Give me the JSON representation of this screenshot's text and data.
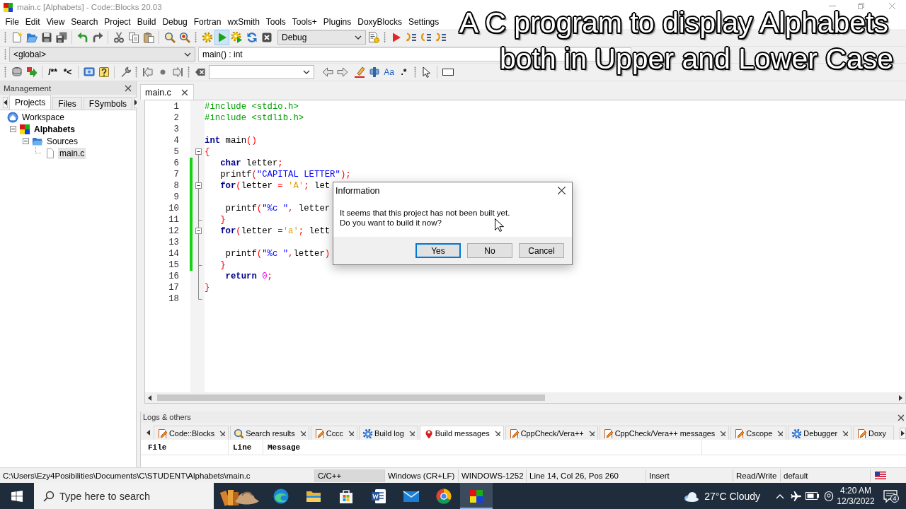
{
  "window": {
    "title": "main.c [Alphabets] - Code::Blocks 20.03"
  },
  "menu": [
    "File",
    "Edit",
    "View",
    "Search",
    "Project",
    "Build",
    "Debug",
    "Fortran",
    "wxSmith",
    "Tools",
    "Tools+",
    "Plugins",
    "DoxyBlocks",
    "Settings"
  ],
  "main_toolbar": {
    "run_highlighted": true,
    "build_target": "Debug"
  },
  "code_toolbar": {
    "scope": "<global>",
    "symbol": "main() : int"
  },
  "doxy_toolbar": {
    "block_comment": "/**",
    "line_comment": "*<"
  },
  "search_toolbar": {
    "match_case": "Aa",
    "regex": ".*"
  },
  "management": {
    "title": "Management",
    "tabs": [
      {
        "label": "Projects",
        "selected": true
      },
      {
        "label": "Files",
        "selected": false
      },
      {
        "label": "FSymbols",
        "selected": false
      }
    ],
    "tree": [
      {
        "label": "Workspace",
        "kind": "workspace",
        "selected": false,
        "active": false,
        "children": [
          {
            "label": "Alphabets",
            "kind": "project",
            "selected": false,
            "active": true,
            "expanded": true,
            "children": [
              {
                "label": "Sources",
                "kind": "folder",
                "selected": false,
                "active": false,
                "expanded": true,
                "children": [
                  {
                    "label": "main.c",
                    "kind": "file",
                    "selected": true,
                    "active": false
                  }
                ]
              }
            ]
          }
        ]
      }
    ]
  },
  "editor": {
    "tabs": [
      {
        "label": "main.c",
        "selected": true
      }
    ],
    "lines": [
      {
        "number": "1",
        "kind": "plain",
        "modified": false,
        "tokens": [
          {
            "kind": "preprocessor",
            "text": "#include <stdio.h>"
          }
        ]
      },
      {
        "number": "2",
        "kind": "plain",
        "modified": false,
        "tokens": [
          {
            "kind": "preprocessor",
            "text": "#include <stdlib.h>"
          }
        ]
      },
      {
        "number": "3",
        "kind": "plain",
        "modified": false
      },
      {
        "number": "4",
        "kind": "plain",
        "modified": false,
        "tokens": [
          {
            "kind": "keyword",
            "text": "int"
          },
          {
            "kind": "plain",
            "text": " main"
          },
          {
            "kind": "operator",
            "text": "()"
          }
        ]
      },
      {
        "number": "5",
        "kind": "fold",
        "modified": false,
        "tokens": [
          {
            "kind": "operator",
            "text": "{"
          }
        ]
      },
      {
        "number": "6",
        "kind": "body",
        "modified": true,
        "tokens": [
          {
            "kind": "keyword",
            "text": "   char"
          },
          {
            "kind": "plain",
            "text": " letter"
          },
          {
            "kind": "operator",
            "text": ";"
          }
        ]
      },
      {
        "number": "7",
        "kind": "body",
        "modified": true,
        "tokens": [
          {
            "kind": "plain",
            "text": "   printf"
          },
          {
            "kind": "operator",
            "text": "("
          },
          {
            "kind": "string",
            "text": "\"CAPITAL LETTER\""
          },
          {
            "kind": "operator",
            "text": ");"
          }
        ]
      },
      {
        "number": "8",
        "kind": "fold",
        "modified": true,
        "tokens": [
          {
            "kind": "keyword",
            "text": "   for"
          },
          {
            "kind": "operator",
            "text": "("
          },
          {
            "kind": "plain",
            "text": "letter "
          },
          {
            "kind": "operator",
            "text": "="
          },
          {
            "kind": "char",
            "text": " 'A'"
          },
          {
            "kind": "operator",
            "text": ";"
          },
          {
            "kind": "plain",
            "text": " let"
          }
        ]
      },
      {
        "number": "9",
        "kind": "body",
        "modified": true
      },
      {
        "number": "10",
        "kind": "body",
        "modified": true,
        "tokens": [
          {
            "kind": "plain",
            "text": "    printf"
          },
          {
            "kind": "operator",
            "text": "("
          },
          {
            "kind": "string",
            "text": "\"%c \""
          },
          {
            "kind": "operator",
            "text": ","
          },
          {
            "kind": "plain",
            "text": " letter"
          }
        ]
      },
      {
        "number": "11",
        "kind": "branch",
        "modified": true,
        "tokens": [
          {
            "kind": "operator",
            "text": "   }"
          }
        ]
      },
      {
        "number": "12",
        "kind": "fold",
        "modified": true,
        "tokens": [
          {
            "kind": "keyword",
            "text": "   for"
          },
          {
            "kind": "operator",
            "text": "("
          },
          {
            "kind": "plain",
            "text": "letter "
          },
          {
            "kind": "operator",
            "text": "="
          },
          {
            "kind": "char",
            "text": "'a'"
          },
          {
            "kind": "operator",
            "text": ";"
          },
          {
            "kind": "plain",
            "text": " lett"
          }
        ]
      },
      {
        "number": "13",
        "kind": "body",
        "modified": true
      },
      {
        "number": "14",
        "kind": "body",
        "modified": true,
        "tokens": [
          {
            "kind": "plain",
            "text": "    printf"
          },
          {
            "kind": "operator",
            "text": "("
          },
          {
            "kind": "string",
            "text": "\"%c \""
          },
          {
            "kind": "operator",
            "text": ","
          },
          {
            "kind": "plain",
            "text": "letter"
          },
          {
            "kind": "operator",
            "text": ")"
          }
        ]
      },
      {
        "number": "15",
        "kind": "branch",
        "modified": true,
        "tokens": [
          {
            "kind": "operator",
            "text": "   }"
          }
        ]
      },
      {
        "number": "16",
        "kind": "body",
        "modified": false,
        "tokens": [
          {
            "kind": "keyword",
            "text": "    return"
          },
          {
            "kind": "number",
            "text": " 0"
          },
          {
            "kind": "operator",
            "text": ";"
          }
        ]
      },
      {
        "number": "17",
        "kind": "body",
        "modified": false,
        "tokens": [
          {
            "kind": "operator",
            "text": "}"
          }
        ]
      },
      {
        "number": "18",
        "kind": "corner",
        "modified": false
      }
    ]
  },
  "dialog": {
    "title": "Information",
    "message": [
      "It seems that this project has not been built yet.",
      "Do you want to build it now?"
    ],
    "buttons": [
      {
        "label": "Yes",
        "focused": true
      },
      {
        "label": "No",
        "focused": false
      },
      {
        "label": "Cancel",
        "focused": false
      }
    ]
  },
  "logs": {
    "title": "Logs & others",
    "tabs": [
      {
        "label": "Code::Blocks",
        "kind": "note",
        "selected": false,
        "closable": true
      },
      {
        "label": "Search results",
        "kind": "search",
        "selected": false,
        "closable": true
      },
      {
        "label": "Cccc",
        "kind": "note",
        "selected": false,
        "closable": true
      },
      {
        "label": "Build log",
        "kind": "gear",
        "selected": false,
        "closable": true
      },
      {
        "label": "Build messages",
        "kind": "pin",
        "selected": true,
        "closable": true
      },
      {
        "label": "CppCheck/Vera++",
        "kind": "note",
        "selected": false,
        "closable": true
      },
      {
        "label": "CppCheck/Vera++ messages",
        "kind": "note",
        "selected": false,
        "closable": true
      },
      {
        "label": "Cscope",
        "kind": "note",
        "selected": false,
        "closable": true
      },
      {
        "label": "Debugger",
        "kind": "gear",
        "selected": false,
        "closable": true
      },
      {
        "label": "Doxy",
        "kind": "note",
        "selected": false,
        "closable": false
      }
    ],
    "columns": [
      "File",
      "Line",
      "Message"
    ]
  },
  "status_bar": [
    {
      "text": "C:\\Users\\Ezy4Posibilities\\Documents\\C\\STUDENT\\Alphabets\\main.c",
      "highlighted": false
    },
    {
      "text": "C/C++",
      "highlighted": true
    },
    {
      "text": "Windows (CR+LF)",
      "highlighted": false
    },
    {
      "text": "WINDOWS-1252",
      "highlighted": false
    },
    {
      "text": "Line 14, Col 26, Pos 260",
      "highlighted": false
    },
    {
      "text": "Insert",
      "highlighted": false
    },
    {
      "text": "Read/Write",
      "highlighted": false
    },
    {
      "text": "default",
      "highlighted": false
    }
  ],
  "taskbar": {
    "search_placeholder": "Type here to search",
    "apps": [
      {
        "kind": "wave",
        "active": false
      },
      {
        "kind": "folder",
        "active": false
      },
      {
        "kind": "bag",
        "active": false
      },
      {
        "kind": "document",
        "active": false
      },
      {
        "kind": "envelope",
        "active": false
      },
      {
        "kind": "wheel",
        "active": false
      },
      {
        "kind": "blocks",
        "active": true
      }
    ],
    "weather": "27°C Cloudy",
    "time": "4:20 AM",
    "date": "12/3/2022",
    "notifications": "4"
  },
  "caption": [
    "A C program to display Alphabets",
    "both in Upper and Lower Case"
  ]
}
